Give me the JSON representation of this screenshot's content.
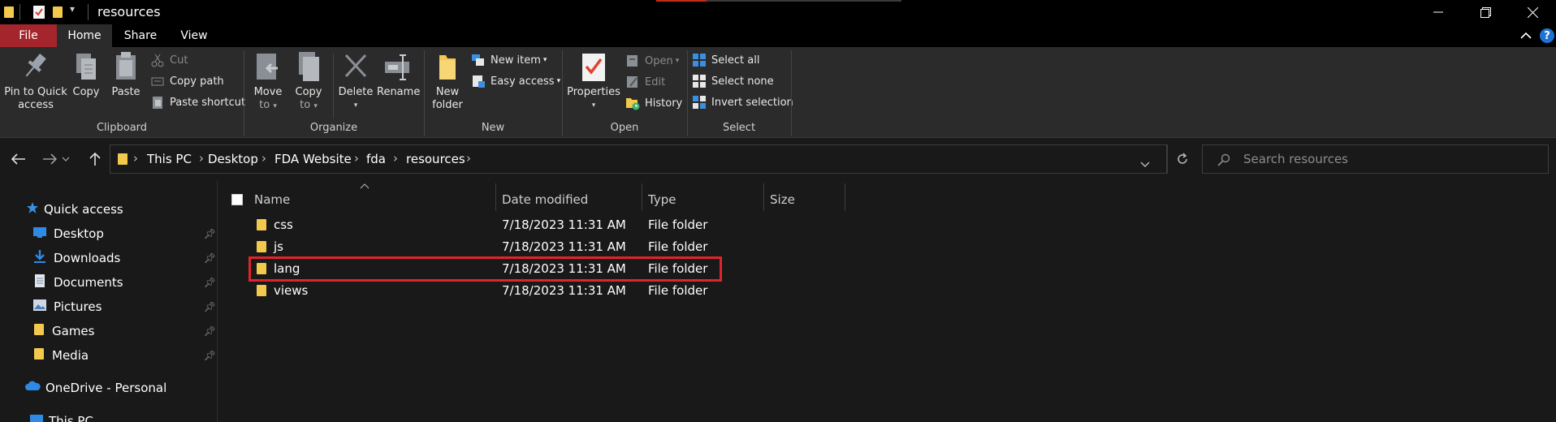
{
  "window": {
    "title": "resources",
    "buttons": [
      "minimize",
      "restore",
      "close"
    ]
  },
  "tabs": {
    "file": "File",
    "home": "Home",
    "share": "Share",
    "view": "View"
  },
  "ribbon": {
    "clipboard": {
      "group_label": "Clipboard",
      "pin_label_1": "Pin to Quick",
      "pin_label_2": "access",
      "copy": "Copy",
      "paste": "Paste",
      "cut": "Cut",
      "copy_path": "Copy path",
      "paste_shortcut": "Paste shortcut"
    },
    "organize": {
      "group_label": "Organize",
      "move_to_1": "Move",
      "move_to_2": "to",
      "copy_to_1": "Copy",
      "copy_to_2": "to",
      "delete": "Delete",
      "rename": "Rename"
    },
    "new": {
      "group_label": "New",
      "new_folder_1": "New",
      "new_folder_2": "folder",
      "new_item": "New item",
      "easy_access": "Easy access"
    },
    "open": {
      "group_label": "Open",
      "properties": "Properties",
      "open": "Open",
      "edit": "Edit",
      "history": "History"
    },
    "select": {
      "group_label": "Select",
      "select_all": "Select all",
      "select_none": "Select none",
      "invert_selection": "Invert selection"
    }
  },
  "address": {
    "crumbs": [
      "This PC",
      "Desktop",
      "FDA Website",
      "fda",
      "resources"
    ],
    "search_placeholder": "Search resources"
  },
  "nav": {
    "quick_access": "Quick access",
    "items": [
      {
        "label": "Desktop",
        "icon": "desktop-icon"
      },
      {
        "label": "Downloads",
        "icon": "download-icon"
      },
      {
        "label": "Documents",
        "icon": "documents-icon"
      },
      {
        "label": "Pictures",
        "icon": "pictures-icon"
      },
      {
        "label": "Games",
        "icon": "folder-icon"
      },
      {
        "label": "Media",
        "icon": "folder-icon"
      }
    ],
    "onedrive": "OneDrive - Personal",
    "this_pc": "This PC"
  },
  "columns": {
    "name": "Name",
    "date": "Date modified",
    "type": "Type",
    "size": "Size"
  },
  "files": [
    {
      "name": "css",
      "date": "7/18/2023 11:31 AM",
      "type": "File folder"
    },
    {
      "name": "js",
      "date": "7/18/2023 11:31 AM",
      "type": "File folder"
    },
    {
      "name": "lang",
      "date": "7/18/2023 11:31 AM",
      "type": "File folder",
      "highlighted": true
    },
    {
      "name": "views",
      "date": "7/18/2023 11:31 AM",
      "type": "File folder"
    }
  ],
  "colors": {
    "accent_red": "#e0242c",
    "folder_yellow": "#f2c94c",
    "blue": "#1e73d2"
  }
}
